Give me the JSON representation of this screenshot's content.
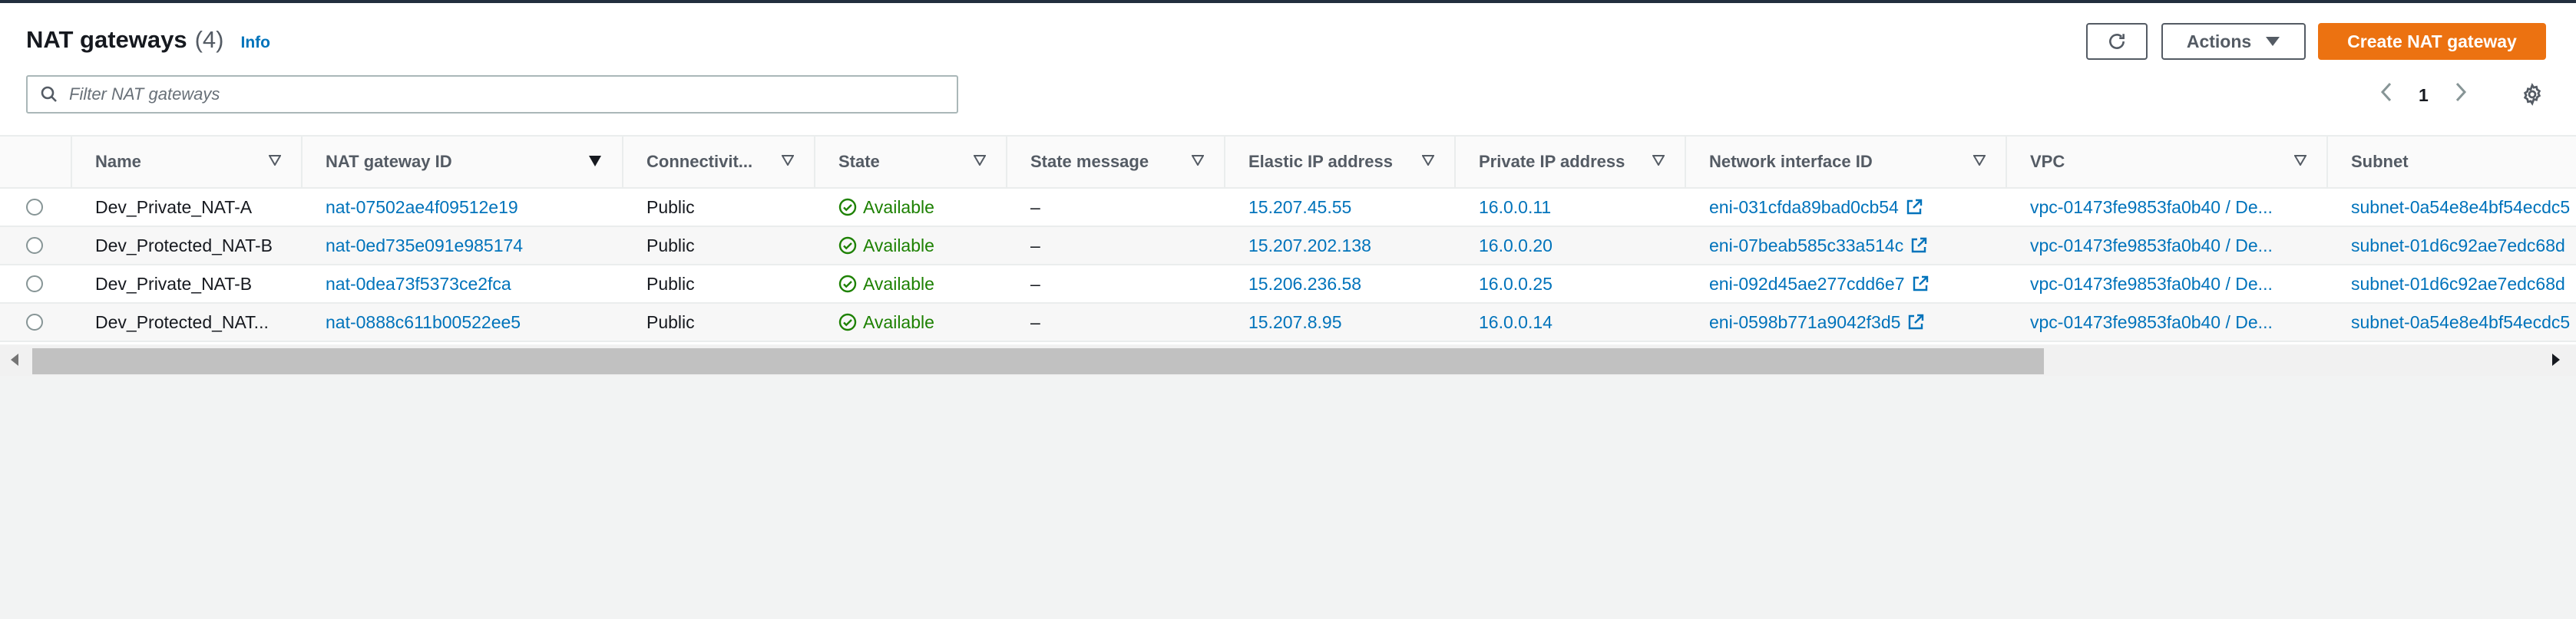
{
  "header": {
    "title": "NAT gateways",
    "count": "(4)",
    "info": "Info",
    "actions_label": "Actions",
    "create_label": "Create NAT gateway"
  },
  "search": {
    "placeholder": "Filter NAT gateways"
  },
  "pagination": {
    "page": "1"
  },
  "columns": [
    "Name",
    "NAT gateway ID",
    "Connectivit...",
    "State",
    "State message",
    "Elastic IP address",
    "Private IP address",
    "Network interface ID",
    "VPC",
    "Subnet"
  ],
  "rows": [
    {
      "name": "Dev_Private_NAT-A",
      "id": "nat-07502ae4f09512e19",
      "connectivity": "Public",
      "state": "Available",
      "message": "–",
      "eip": "15.207.45.55",
      "private_ip": "16.0.0.11",
      "eni": "eni-031cfda89bad0cb54",
      "vpc": "vpc-01473fe9853fa0b40 / De...",
      "subnet": "subnet-0a54e8e4bf54ecdc5"
    },
    {
      "name": "Dev_Protected_NAT-B",
      "id": "nat-0ed735e091e985174",
      "connectivity": "Public",
      "state": "Available",
      "message": "–",
      "eip": "15.207.202.138",
      "private_ip": "16.0.0.20",
      "eni": "eni-07beab585c33a514c",
      "vpc": "vpc-01473fe9853fa0b40 / De...",
      "subnet": "subnet-01d6c92ae7edc68d"
    },
    {
      "name": "Dev_Private_NAT-B",
      "id": "nat-0dea73f5373ce2fca",
      "connectivity": "Public",
      "state": "Available",
      "message": "–",
      "eip": "15.206.236.58",
      "private_ip": "16.0.0.25",
      "eni": "eni-092d45ae277cdd6e7",
      "vpc": "vpc-01473fe9853fa0b40 / De...",
      "subnet": "subnet-01d6c92ae7edc68d"
    },
    {
      "name": "Dev_Protected_NAT...",
      "id": "nat-0888c611b00522ee5",
      "connectivity": "Public",
      "state": "Available",
      "message": "–",
      "eip": "15.207.8.95",
      "private_ip": "16.0.0.14",
      "eni": "eni-0598b771a9042f3d5",
      "vpc": "vpc-01473fe9853fa0b40 / De...",
      "subnet": "subnet-0a54e8e4bf54ecdc5"
    }
  ],
  "colors": {
    "link": "#0073bb",
    "available": "#1d8102",
    "primary_button": "#ec7211"
  },
  "icons": {
    "refresh": "refresh-icon",
    "actions_caret": "caret-down-icon",
    "search": "search-icon",
    "prev": "chevron-left-icon",
    "next": "chevron-right-icon",
    "settings": "gear-icon",
    "status": "check-circle-icon",
    "external": "external-link-icon"
  }
}
